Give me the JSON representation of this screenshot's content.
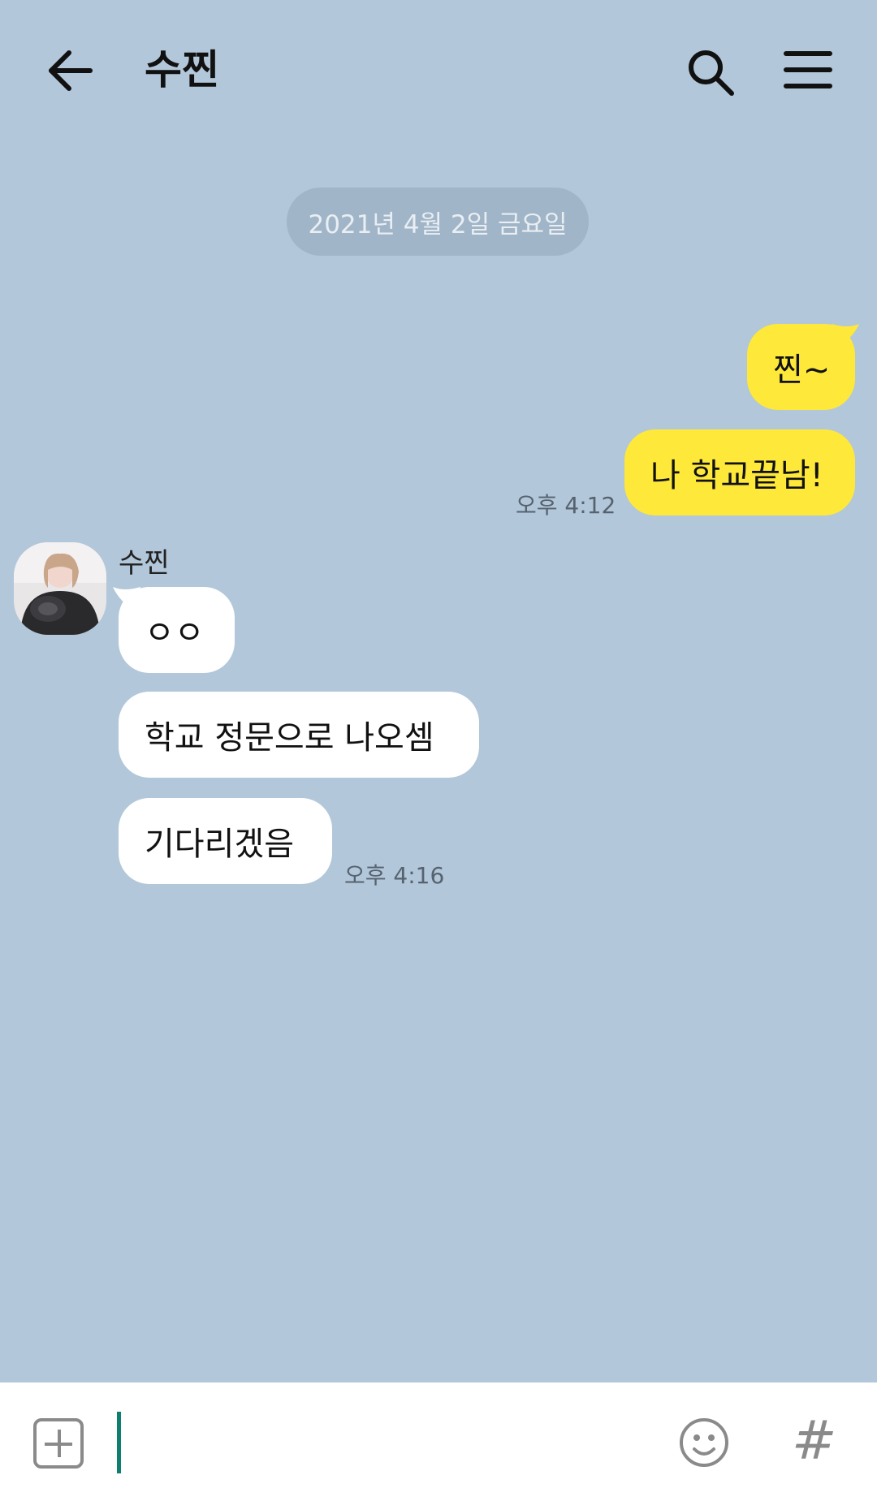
{
  "header": {
    "title": "수찐",
    "back_icon": "arrow-left-icon",
    "search_icon": "search-icon",
    "menu_icon": "hamburger-menu-icon"
  },
  "date_divider": "2021년 4월 2일 금요일",
  "messages": [
    {
      "sender": "me",
      "text": "찐~"
    },
    {
      "sender": "me",
      "text": "나 학교끝남!",
      "time": "오후 4:12"
    },
    {
      "sender": "them",
      "name": "수찐",
      "text": "ㅇㅇ"
    },
    {
      "sender": "them",
      "text": "학교 정문으로 나오셈"
    },
    {
      "sender": "them",
      "text": "기다리겠음",
      "time": "오후 4:16"
    }
  ],
  "input_bar": {
    "plus_icon": "plus-square-icon",
    "emoji_icon": "smiley-icon",
    "hash_label": "#"
  },
  "colors": {
    "background": "#b2c7d9",
    "my_bubble": "#fee83a",
    "their_bubble": "#ffffff"
  }
}
